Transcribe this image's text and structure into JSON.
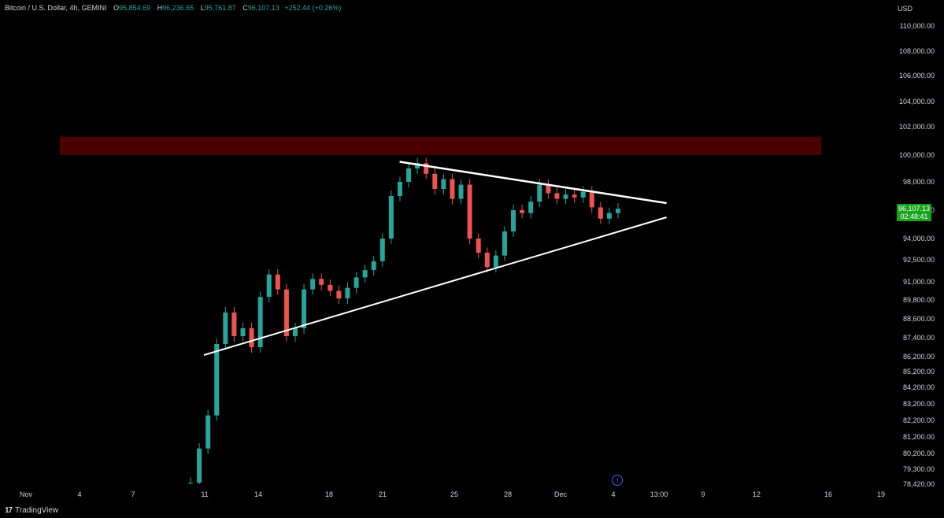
{
  "legend": {
    "symbol": "Bitcoin / U.S. Dollar, 4h, GEMINI",
    "open_label": "O",
    "open": "95,854.69",
    "high_label": "H",
    "high": "96,236.65",
    "low_label": "L",
    "low": "95,761.87",
    "close_label": "C",
    "close": "96,107.13",
    "change": "+252.44 (+0.26%)"
  },
  "currency": "USD",
  "last_price": {
    "value": "96,107.13",
    "countdown": "02:48:41",
    "color": "#17a31a"
  },
  "brand": {
    "logo": "17",
    "name": "TradingView"
  },
  "colors": {
    "up": "#26a69a",
    "down": "#ef5350",
    "zone": "#4a0000",
    "trend": "#ffffff"
  },
  "chart_data": {
    "type": "candlestick",
    "timeframe": "4h",
    "y_axis": {
      "scale": "log",
      "range": [
        78000,
        111000
      ],
      "tick_labels": [
        "110,000.00",
        "108,000.00",
        "106,000.00",
        "104,000.00",
        "102,000.00",
        "100,000.00",
        "98,000.00",
        "96,000.00",
        "94,000.00",
        "92,500.00",
        "91,000.00",
        "89,800.00",
        "88,600.00",
        "87,400.00",
        "86,200.00",
        "85,200.00",
        "84,200.00",
        "83,200.00",
        "82,200.00",
        "81,200.00",
        "80,200.00",
        "79,300.00",
        "78,420.00"
      ]
    },
    "x_axis": {
      "tick_labels": [
        "Nov",
        "4",
        "7",
        "11",
        "14",
        "18",
        "21",
        "25",
        "28",
        "Dec",
        "4",
        "13:00",
        "9",
        "12",
        "16",
        "19"
      ]
    },
    "resistance_zone": [
      100000,
      101300
    ],
    "upper_trendline": {
      "from": [
        "2024-11-22",
        99500
      ],
      "to": [
        "2024-12-07",
        96500
      ]
    },
    "lower_trendline": {
      "from": [
        "2024-11-11",
        86300
      ],
      "to": [
        "2024-12-07",
        95500
      ]
    },
    "price_path": [
      [
        "2024-11-10",
        78500
      ],
      [
        "2024-11-10",
        80500
      ],
      [
        "2024-11-11",
        82500
      ],
      [
        "2024-11-11",
        87000
      ],
      [
        "2024-11-11",
        89000
      ],
      [
        "2024-11-12",
        87500
      ],
      [
        "2024-11-12",
        88000
      ],
      [
        "2024-11-13",
        86800
      ],
      [
        "2024-11-13",
        90000
      ],
      [
        "2024-11-14",
        91500
      ],
      [
        "2024-11-14",
        90500
      ],
      [
        "2024-11-15",
        87500
      ],
      [
        "2024-11-15",
        88000
      ],
      [
        "2024-11-16",
        90500
      ],
      [
        "2024-11-16",
        91200
      ],
      [
        "2024-11-17",
        90800
      ],
      [
        "2024-11-17",
        90400
      ],
      [
        "2024-11-18",
        89900
      ],
      [
        "2024-11-18",
        90600
      ],
      [
        "2024-11-19",
        91300
      ],
      [
        "2024-11-19",
        91800
      ],
      [
        "2024-11-20",
        92400
      ],
      [
        "2024-11-20",
        94000
      ],
      [
        "2024-11-21",
        97000
      ],
      [
        "2024-11-21",
        98000
      ],
      [
        "2024-11-22",
        99000
      ],
      [
        "2024-11-22",
        99400
      ],
      [
        "2024-11-23",
        98600
      ],
      [
        "2024-11-24",
        97500
      ],
      [
        "2024-11-24",
        98200
      ],
      [
        "2024-11-25",
        96800
      ],
      [
        "2024-11-25",
        97800
      ],
      [
        "2024-11-26",
        94000
      ],
      [
        "2024-11-26",
        93000
      ],
      [
        "2024-11-27",
        92000
      ],
      [
        "2024-11-27",
        92800
      ],
      [
        "2024-11-28",
        94500
      ],
      [
        "2024-11-28",
        96000
      ],
      [
        "2024-11-29",
        95800
      ],
      [
        "2024-11-29",
        96600
      ],
      [
        "2024-11-30",
        97800
      ],
      [
        "2024-11-30",
        97200
      ],
      [
        "2024-12-01",
        96800
      ],
      [
        "2024-12-01",
        97100
      ],
      [
        "2024-12-02",
        96900
      ],
      [
        "2024-12-02",
        97300
      ],
      [
        "2024-12-03",
        96200
      ],
      [
        "2024-12-03",
        95400
      ],
      [
        "2024-12-04",
        95800
      ],
      [
        "2024-12-04",
        96107
      ]
    ]
  }
}
